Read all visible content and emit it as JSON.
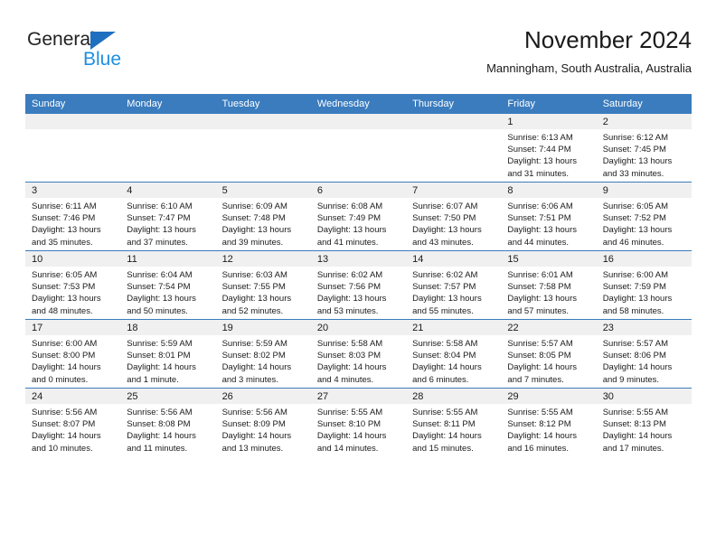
{
  "brand": {
    "name_line1": "General",
    "name_line2": "Blue",
    "accent_color": "#1f6fc0",
    "accent_color_light": "#1f8fe0"
  },
  "header": {
    "title": "November 2024",
    "subtitle": "Manningham, South Australia, Australia"
  },
  "theme": {
    "header_row_bg": "#3a7cbe",
    "daynum_strip_bg": "#f0f0f0",
    "grid_line": "#3a7cbe",
    "text": "#1a1a1a"
  },
  "weekdays": [
    "Sunday",
    "Monday",
    "Tuesday",
    "Wednesday",
    "Thursday",
    "Friday",
    "Saturday"
  ],
  "weeks": [
    [
      {
        "day": ""
      },
      {
        "day": ""
      },
      {
        "day": ""
      },
      {
        "day": ""
      },
      {
        "day": ""
      },
      {
        "day": "1",
        "sunrise": "Sunrise: 6:13 AM",
        "sunset": "Sunset: 7:44 PM",
        "daylight": "Daylight: 13 hours and 31 minutes."
      },
      {
        "day": "2",
        "sunrise": "Sunrise: 6:12 AM",
        "sunset": "Sunset: 7:45 PM",
        "daylight": "Daylight: 13 hours and 33 minutes."
      }
    ],
    [
      {
        "day": "3",
        "sunrise": "Sunrise: 6:11 AM",
        "sunset": "Sunset: 7:46 PM",
        "daylight": "Daylight: 13 hours and 35 minutes."
      },
      {
        "day": "4",
        "sunrise": "Sunrise: 6:10 AM",
        "sunset": "Sunset: 7:47 PM",
        "daylight": "Daylight: 13 hours and 37 minutes."
      },
      {
        "day": "5",
        "sunrise": "Sunrise: 6:09 AM",
        "sunset": "Sunset: 7:48 PM",
        "daylight": "Daylight: 13 hours and 39 minutes."
      },
      {
        "day": "6",
        "sunrise": "Sunrise: 6:08 AM",
        "sunset": "Sunset: 7:49 PM",
        "daylight": "Daylight: 13 hours and 41 minutes."
      },
      {
        "day": "7",
        "sunrise": "Sunrise: 6:07 AM",
        "sunset": "Sunset: 7:50 PM",
        "daylight": "Daylight: 13 hours and 43 minutes."
      },
      {
        "day": "8",
        "sunrise": "Sunrise: 6:06 AM",
        "sunset": "Sunset: 7:51 PM",
        "daylight": "Daylight: 13 hours and 44 minutes."
      },
      {
        "day": "9",
        "sunrise": "Sunrise: 6:05 AM",
        "sunset": "Sunset: 7:52 PM",
        "daylight": "Daylight: 13 hours and 46 minutes."
      }
    ],
    [
      {
        "day": "10",
        "sunrise": "Sunrise: 6:05 AM",
        "sunset": "Sunset: 7:53 PM",
        "daylight": "Daylight: 13 hours and 48 minutes."
      },
      {
        "day": "11",
        "sunrise": "Sunrise: 6:04 AM",
        "sunset": "Sunset: 7:54 PM",
        "daylight": "Daylight: 13 hours and 50 minutes."
      },
      {
        "day": "12",
        "sunrise": "Sunrise: 6:03 AM",
        "sunset": "Sunset: 7:55 PM",
        "daylight": "Daylight: 13 hours and 52 minutes."
      },
      {
        "day": "13",
        "sunrise": "Sunrise: 6:02 AM",
        "sunset": "Sunset: 7:56 PM",
        "daylight": "Daylight: 13 hours and 53 minutes."
      },
      {
        "day": "14",
        "sunrise": "Sunrise: 6:02 AM",
        "sunset": "Sunset: 7:57 PM",
        "daylight": "Daylight: 13 hours and 55 minutes."
      },
      {
        "day": "15",
        "sunrise": "Sunrise: 6:01 AM",
        "sunset": "Sunset: 7:58 PM",
        "daylight": "Daylight: 13 hours and 57 minutes."
      },
      {
        "day": "16",
        "sunrise": "Sunrise: 6:00 AM",
        "sunset": "Sunset: 7:59 PM",
        "daylight": "Daylight: 13 hours and 58 minutes."
      }
    ],
    [
      {
        "day": "17",
        "sunrise": "Sunrise: 6:00 AM",
        "sunset": "Sunset: 8:00 PM",
        "daylight": "Daylight: 14 hours and 0 minutes."
      },
      {
        "day": "18",
        "sunrise": "Sunrise: 5:59 AM",
        "sunset": "Sunset: 8:01 PM",
        "daylight": "Daylight: 14 hours and 1 minute."
      },
      {
        "day": "19",
        "sunrise": "Sunrise: 5:59 AM",
        "sunset": "Sunset: 8:02 PM",
        "daylight": "Daylight: 14 hours and 3 minutes."
      },
      {
        "day": "20",
        "sunrise": "Sunrise: 5:58 AM",
        "sunset": "Sunset: 8:03 PM",
        "daylight": "Daylight: 14 hours and 4 minutes."
      },
      {
        "day": "21",
        "sunrise": "Sunrise: 5:58 AM",
        "sunset": "Sunset: 8:04 PM",
        "daylight": "Daylight: 14 hours and 6 minutes."
      },
      {
        "day": "22",
        "sunrise": "Sunrise: 5:57 AM",
        "sunset": "Sunset: 8:05 PM",
        "daylight": "Daylight: 14 hours and 7 minutes."
      },
      {
        "day": "23",
        "sunrise": "Sunrise: 5:57 AM",
        "sunset": "Sunset: 8:06 PM",
        "daylight": "Daylight: 14 hours and 9 minutes."
      }
    ],
    [
      {
        "day": "24",
        "sunrise": "Sunrise: 5:56 AM",
        "sunset": "Sunset: 8:07 PM",
        "daylight": "Daylight: 14 hours and 10 minutes."
      },
      {
        "day": "25",
        "sunrise": "Sunrise: 5:56 AM",
        "sunset": "Sunset: 8:08 PM",
        "daylight": "Daylight: 14 hours and 11 minutes."
      },
      {
        "day": "26",
        "sunrise": "Sunrise: 5:56 AM",
        "sunset": "Sunset: 8:09 PM",
        "daylight": "Daylight: 14 hours and 13 minutes."
      },
      {
        "day": "27",
        "sunrise": "Sunrise: 5:55 AM",
        "sunset": "Sunset: 8:10 PM",
        "daylight": "Daylight: 14 hours and 14 minutes."
      },
      {
        "day": "28",
        "sunrise": "Sunrise: 5:55 AM",
        "sunset": "Sunset: 8:11 PM",
        "daylight": "Daylight: 14 hours and 15 minutes."
      },
      {
        "day": "29",
        "sunrise": "Sunrise: 5:55 AM",
        "sunset": "Sunset: 8:12 PM",
        "daylight": "Daylight: 14 hours and 16 minutes."
      },
      {
        "day": "30",
        "sunrise": "Sunrise: 5:55 AM",
        "sunset": "Sunset: 8:13 PM",
        "daylight": "Daylight: 14 hours and 17 minutes."
      }
    ]
  ]
}
